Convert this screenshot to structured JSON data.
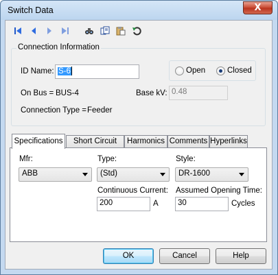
{
  "window": {
    "title": "Switch Data",
    "close_glyph": "X"
  },
  "toolbar": {
    "icons": [
      "first-record-icon",
      "previous-record-icon",
      "next-record-icon",
      "last-record-icon",
      "find-icon",
      "copy-icon",
      "paste-icon",
      "undo-icon"
    ]
  },
  "connection": {
    "legend": "Connection Information",
    "id_label": "ID Name:",
    "id_value": "S-6",
    "on_bus_label": "On Bus =",
    "on_bus_value": "BUS-4",
    "base_kv_label": "Base kV:",
    "base_kv_value": "0.48",
    "connection_type_label": "Connection Type =",
    "connection_type_value": "Feeder",
    "state_options": [
      {
        "label": "Open",
        "selected": false
      },
      {
        "label": "Closed",
        "selected": true
      }
    ]
  },
  "tabs": [
    "Specifications",
    "Short Circuit",
    "Harmonics",
    "Comments",
    "Hyperlinks"
  ],
  "active_tab": "Specifications",
  "specifications": {
    "mfr_label": "Mfr:",
    "mfr_value": "ABB",
    "type_label": "Type:",
    "type_value": "(Std)",
    "style_label": "Style:",
    "style_value": "DR-1600",
    "continuous_current_label": "Continuous Current:",
    "continuous_current_value": "200",
    "continuous_current_unit": "A",
    "opening_time_label": "Assumed Opening Time:",
    "opening_time_value": "30",
    "opening_time_unit": "Cycles"
  },
  "buttons": {
    "ok": "OK",
    "cancel": "Cancel",
    "help": "Help"
  },
  "colors": {
    "title_gradient_top": "#d5e6f7",
    "close_button": "#c7462f",
    "selection": "#3399ff",
    "dialog_bg": "#f0f0f0"
  }
}
